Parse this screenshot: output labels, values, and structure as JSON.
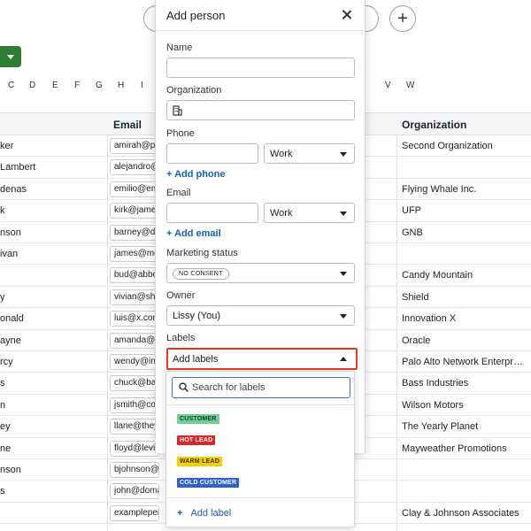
{
  "background": {
    "column_letters": [
      "C",
      "D",
      "E",
      "F",
      "G",
      "H",
      "I",
      "V",
      "W"
    ],
    "headers": {
      "email": "Email",
      "organization": "Organization"
    },
    "rows": [
      {
        "name": "ker",
        "email": "amirah@pe",
        "org": "Second Organization"
      },
      {
        "name": "Lambert",
        "email": "alejandro@",
        "org": ""
      },
      {
        "name": "denas",
        "email": "emilio@em",
        "org": "Flying Whale Inc."
      },
      {
        "name": "k",
        "email": "kirk@james",
        "org": "UFP"
      },
      {
        "name": "nson",
        "email": "barney@do",
        "org": "GNB"
      },
      {
        "name": "ivan",
        "email": "james@mo",
        "org": ""
      },
      {
        "name": "",
        "email": "bud@abbo",
        "org": "Candy Mountain"
      },
      {
        "name": "y",
        "email": "vivian@shi",
        "org": "Shield"
      },
      {
        "name": "onald",
        "email": "luis@x.com",
        "org": "Innovation X"
      },
      {
        "name": "ayne",
        "email": "amanda@p",
        "org": "Oracle"
      },
      {
        "name": "rcy",
        "email": "wendy@ind",
        "org": "Palo Alto Network Enterpr…"
      },
      {
        "name": "s",
        "email": "chuck@bas",
        "org": "Bass Industries"
      },
      {
        "name": "n",
        "email": "jsmith@co",
        "org": "Wilson Motors"
      },
      {
        "name": "ey",
        "email": "llane@they",
        "org": "The Yearly Planet"
      },
      {
        "name": "ne",
        "email": "floyd@levi",
        "org": "Mayweather Promotions"
      },
      {
        "name": "nson",
        "email": "bjohnson@jo",
        "org": ""
      },
      {
        "name": "s",
        "email": "john@domai",
        "org": ""
      },
      {
        "name": "",
        "email": "examplepers",
        "org": "Clay & Johnson Associates"
      }
    ]
  },
  "modal": {
    "title": "Add person",
    "name_label": "Name",
    "name_value": "",
    "organization_label": "Organization",
    "organization_value": "",
    "phone_label": "Phone",
    "phone_value": "",
    "phone_type": "Work",
    "add_phone": "+ Add phone",
    "email_label": "Email",
    "email_value": "",
    "email_type": "Work",
    "add_email": "+ Add email",
    "marketing_label": "Marketing status",
    "marketing_value": "NO CONSENT",
    "owner_label": "Owner",
    "owner_value": "Lissy (You)",
    "labels_label": "Labels",
    "labels_placeholder": "Add labels"
  },
  "dropdown": {
    "search_placeholder": "Search for labels",
    "labels": [
      {
        "text": "CUSTOMER",
        "bg": "#6fcf97",
        "fg": "#1b3a27"
      },
      {
        "text": "HOT LEAD",
        "bg": "#d62828",
        "fg": "#ffffff"
      },
      {
        "text": "WARM LEAD",
        "bg": "#f4d000",
        "fg": "#3a3000"
      },
      {
        "text": "COLD CUSTOMER",
        "bg": "#2f5fd0",
        "fg": "#ffffff"
      }
    ],
    "add_label": "Add label"
  }
}
